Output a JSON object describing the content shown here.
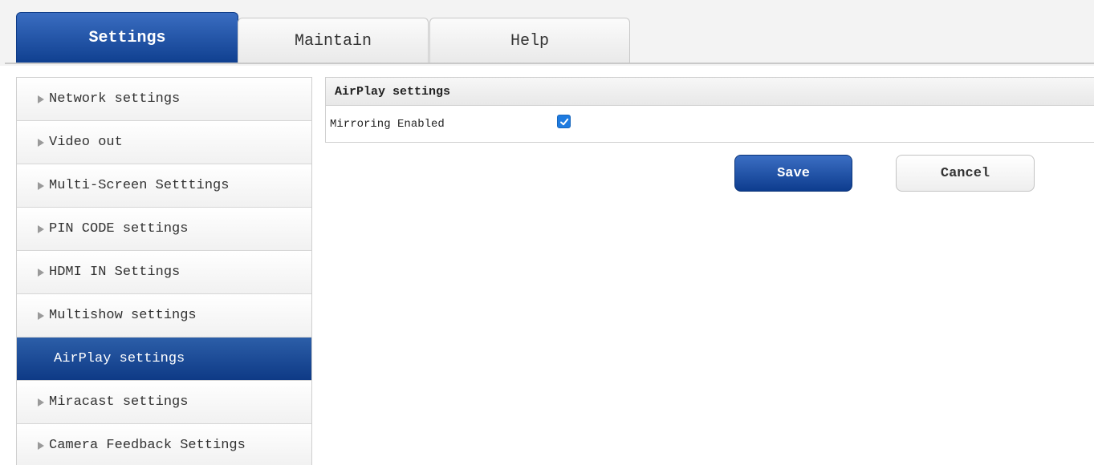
{
  "tabs": [
    {
      "label": "Settings",
      "active": true
    },
    {
      "label": "Maintain",
      "active": false
    },
    {
      "label": "Help",
      "active": false
    }
  ],
  "sidebar": {
    "items": [
      {
        "label": "Network settings",
        "active": false
      },
      {
        "label": "Video out",
        "active": false
      },
      {
        "label": "Multi-Screen Setttings",
        "active": false
      },
      {
        "label": "PIN CODE settings",
        "active": false
      },
      {
        "label": "HDMI IN Settings",
        "active": false
      },
      {
        "label": "Multishow settings",
        "active": false
      },
      {
        "label": "AirPlay settings",
        "active": true
      },
      {
        "label": "Miracast settings",
        "active": false
      },
      {
        "label": "Camera Feedback Settings",
        "active": false
      }
    ]
  },
  "panel": {
    "title": "AirPlay settings",
    "mirroring_label": "Mirroring Enabled",
    "mirroring_checked": true
  },
  "actions": {
    "save_label": "Save",
    "cancel_label": "Cancel"
  },
  "colors": {
    "accent": "#0f3f8f",
    "checkbox": "#1e7be0"
  },
  "icons": {
    "sidebar_arrow": "triangle-right-icon",
    "checkbox_mark": "check-icon"
  }
}
